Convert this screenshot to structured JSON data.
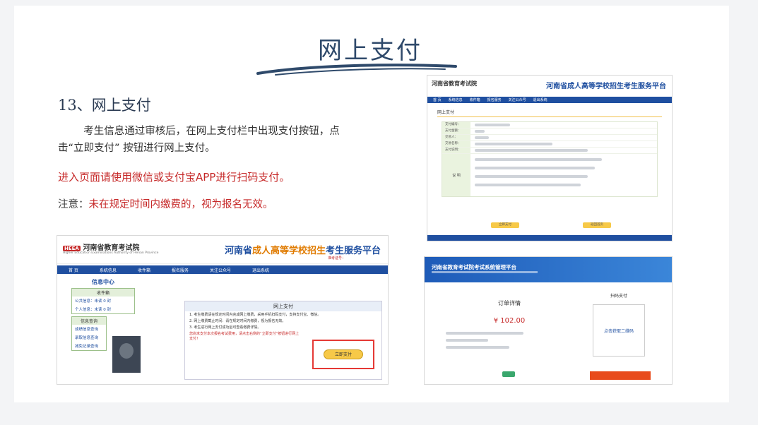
{
  "slide": {
    "title": "网上支付",
    "section_heading": "13、网上支付",
    "paragraph": "考生信息通过审核后，在网上支付栏中出现支付按钮，点击“立即支付” 按钮进行网上支付。",
    "red_line": "进入页面请使用微信或支付宝APP进行扫码支付。",
    "note_prefix": "注意：",
    "note_red": "未在规定时间内缴费的，视为报名无效。"
  },
  "shot1": {
    "logo": "河南省教育考试院",
    "logo_badge": "HEEA",
    "sub": "Higher Education Examinations Authority of Henan Province",
    "platform_blue1": "河南省",
    "platform_orange": "成人高等学校招生",
    "platform_blue2": "考生服务平台",
    "reg": "准考证号：",
    "nav": [
      "首 页",
      "系统信息",
      "收件箱",
      "报名服务",
      "关注公众号",
      "退出系统"
    ],
    "info_center": "信息中心",
    "inbox_header": "收件箱",
    "inbox_items": [
      "公共信息：未读 0 封",
      "个人信息：未读 0 封"
    ],
    "query_header": "信息查询",
    "query_items": [
      "成绩信息查询",
      "录取信息查询",
      "减免记录查询"
    ],
    "main_header": "网上支付",
    "main_lines": [
      "1. 考生缴费请在规定时间内完成网上缴费，采用手机扫码支付，支持支付宝、微信。",
      "2. 网上缴费截止时间：请在规定时间内缴费，视为报名无效。",
      "3. 考生进行网上支付成功后可查看缴费详情。"
    ],
    "main_red": "您尚未支付本次报名考试费用，请点击右侧的“立即支付”按钮进行网上支付！",
    "pay_button": "立即支付"
  },
  "shot2": {
    "logo": "河南省教育考试院",
    "platform": "河南省成人高等学校招生考生服务平台",
    "nav": [
      "首 页",
      "系统信息",
      "收件箱",
      "报名服务",
      "关注公众号",
      "退出系统"
    ],
    "section": "网上支付",
    "rows": [
      "支付编号：",
      "支付金额：",
      "交易人：",
      "交易名称：",
      "支付说明："
    ],
    "explain_label": "说 明",
    "btn_left": "立即支付",
    "btn_right": "返回首页"
  },
  "shot3": {
    "banner_title": "河南省教育考试院考试系统管理平台",
    "order_title": "订单详情",
    "price": "¥ 102.00",
    "scan_title": "扫码支付",
    "qr_text": "点击获取二维码"
  }
}
